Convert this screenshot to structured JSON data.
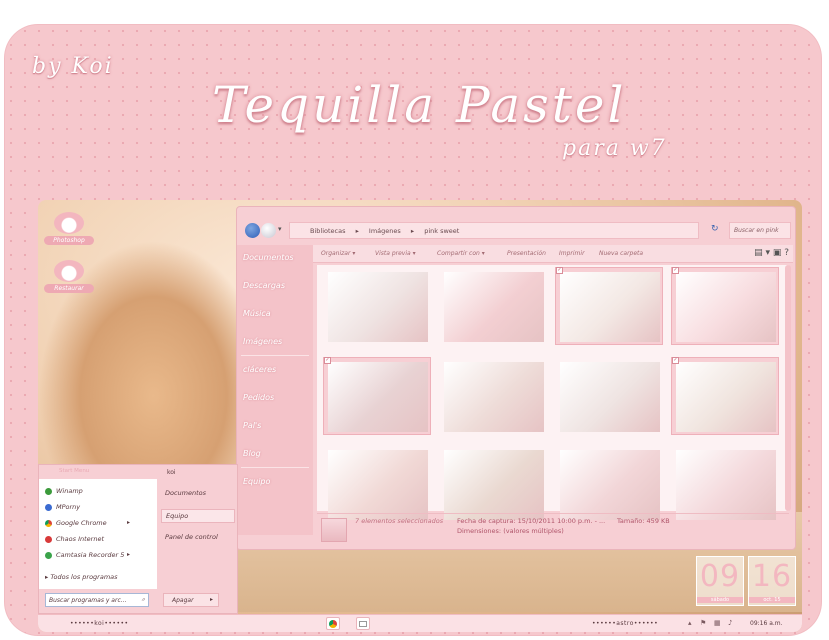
{
  "header": {
    "signature": "by Koi",
    "title": "Tequilla Pastel",
    "subtitle": "para w7"
  },
  "desktop_icons": [
    {
      "label": "Photoshop"
    },
    {
      "label": "Restaurar"
    }
  ],
  "explorer": {
    "breadcrumb": [
      "Bibliotecas",
      "Imágenes",
      "pink sweet"
    ],
    "search_placeholder": "Buscar en pink",
    "toolbar": [
      "Organizar ▾",
      "Vista previa ▾",
      "Compartir con ▾",
      "Presentación",
      "Imprimir",
      "Nueva carpeta"
    ],
    "sidebar": [
      "Documentos",
      "Descargas",
      "Música",
      "Imágenes",
      "cláceres",
      "Pedidos",
      "Pal's",
      "Blog",
      "Equipo"
    ],
    "thumbnails": [
      {
        "selected": false,
        "checked": false,
        "tone": "#efe3e2"
      },
      {
        "selected": false,
        "checked": false,
        "tone": "#f3cfd2"
      },
      {
        "selected": true,
        "checked": true,
        "tone": "#f3e8e4"
      },
      {
        "selected": true,
        "checked": true,
        "tone": "#f8dde0"
      },
      {
        "selected": true,
        "checked": true,
        "tone": "#e8d2d3"
      },
      {
        "selected": false,
        "checked": false,
        "tone": "#eedcd8"
      },
      {
        "selected": false,
        "checked": false,
        "tone": "#efe4e2"
      },
      {
        "selected": true,
        "checked": true,
        "tone": "#f0e4de"
      },
      {
        "selected": false,
        "checked": false,
        "tone": "#f1d9d6"
      },
      {
        "selected": false,
        "checked": false,
        "tone": "#ead9d1"
      },
      {
        "selected": false,
        "checked": false,
        "tone": "#f2d6d8"
      },
      {
        "selected": false,
        "checked": false,
        "tone": "#f4d9dc"
      }
    ],
    "details": {
      "selection": "7 elementos seleccionados",
      "capture_date": "Fecha de captura: 15/10/2011 10:00 p.m. - ...",
      "size": "Tamaño: 459 KB",
      "dimensions": "Dimensiones: (valores múltiples)"
    }
  },
  "start_menu": {
    "title": "Start Menu",
    "user": "koi",
    "programs": [
      "Winamp",
      "MPorny",
      "Google Chrome",
      "Chaos Internet",
      "Camtasia Recorder 5"
    ],
    "all_programs": "Todos los programas",
    "right_items": [
      "Documentos",
      "Equipo",
      "Panel de control"
    ],
    "search_placeholder": "Buscar programas y arc...",
    "shutdown": "Apagar"
  },
  "clock": {
    "hour": "09",
    "minute": "16",
    "hour_caption": "sábado",
    "minute_caption": "oct. 15"
  },
  "taskbar": {
    "left_text": "••••••koi••••••",
    "right_text": "••••••astro••••••",
    "time": "09:16 a.m."
  },
  "colors": {
    "frame": "#f6c8cd",
    "accent": "#eea9b3",
    "window": "#f7cfd4"
  }
}
